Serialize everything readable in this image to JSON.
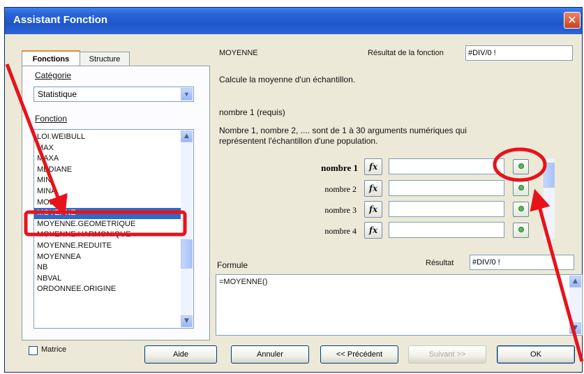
{
  "window": {
    "title": "Assistant Fonction",
    "close_glyph": "✕"
  },
  "tabs": [
    {
      "label": "Fonctions",
      "active": true
    },
    {
      "label": "Structure",
      "active": false
    }
  ],
  "category": {
    "label": "Catégorie",
    "value": "Statistique"
  },
  "function_list": {
    "label": "Fonction",
    "items": [
      "LOI.WEIBULL",
      "MAX",
      "MAXA",
      "MEDIANE",
      "MIN",
      "MINA",
      "MODE",
      "MOYENNE",
      "MOYENNE.GEOMETRIQUE",
      "MOYENNE.HARMONIQUE",
      "MOYENNE.REDUITE",
      "MOYENNEA",
      "NB",
      "NBVAL",
      "ORDONNEE.ORIGINE"
    ],
    "selected": "MOYENNE"
  },
  "matrix_checkbox": {
    "label": "Matrice",
    "checked": false
  },
  "right": {
    "function_name": "MOYENNE",
    "result_label": "Résultat de la fonction",
    "result_value": "#DIV/0 !",
    "description": "Calcule la moyenne d'un échantillon.",
    "param_title": "nombre 1 (requis)",
    "param_description_1": "Nombre 1, nombre 2, .... sont de 1 à 30 arguments numériques qui",
    "param_description_2": "représentent l'échantillon d'une population.",
    "args": [
      {
        "label": "nombre 1",
        "bold": true,
        "value": ""
      },
      {
        "label": "nombre 2",
        "bold": false,
        "value": ""
      },
      {
        "label": "nombre 3",
        "bold": false,
        "value": ""
      },
      {
        "label": "nombre 4",
        "bold": false,
        "value": ""
      }
    ],
    "fx_glyph": "fx",
    "formula_label": "Formule",
    "formula_value": "=MOYENNE()",
    "result2_label": "Résultat",
    "result2_value": "#DIV/0 !"
  },
  "buttons": {
    "help": "Aide",
    "cancel": "Annuler",
    "previous": "<< Précédent",
    "next": "Suivant >>",
    "ok": "OK"
  },
  "annotation_color": "#e8121b"
}
